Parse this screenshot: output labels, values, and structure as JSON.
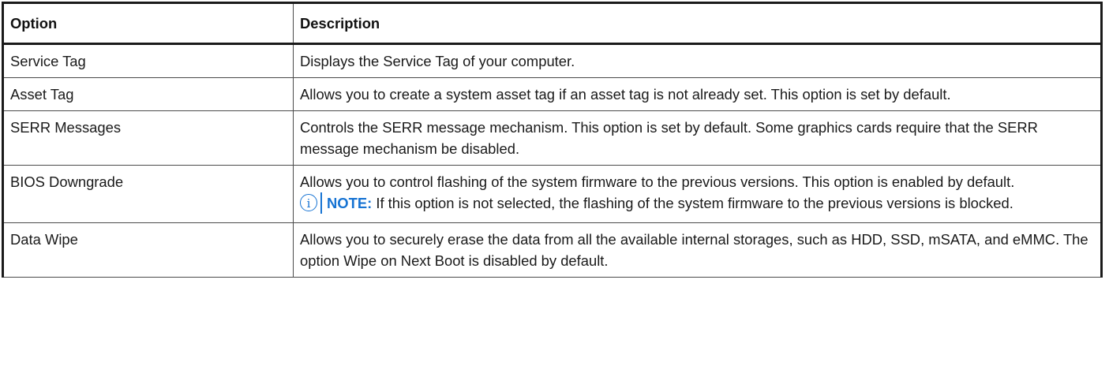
{
  "table": {
    "headers": {
      "option": "Option",
      "description": "Description"
    },
    "rows": [
      {
        "option": "Service Tag",
        "description": "Displays the Service Tag of your computer."
      },
      {
        "option": "Asset Tag",
        "description": "Allows you to create a system asset tag if an asset tag is not already set. This option is set by default."
      },
      {
        "option": "SERR Messages",
        "description": "Controls the SERR message mechanism. This option is set by default. Some graphics cards require that the SERR message mechanism be disabled."
      },
      {
        "option": "BIOS Downgrade",
        "description": "Allows you to control flashing of the system firmware to the previous versions. This option is enabled by default.",
        "note_label": "NOTE:",
        "note_text": " If this option is not selected, the flashing of the system firmware to the previous versions is blocked.",
        "note_icon": "info-icon"
      },
      {
        "option": "Data Wipe",
        "description": "Allows you to securely erase the data from all the available internal storages, such as HDD, SSD, mSATA, and eMMC. The option Wipe on Next Boot is disabled by default."
      }
    ]
  },
  "colors": {
    "note_accent": "#1673d3",
    "border": "#1a1a1a",
    "text": "#1a1a1a"
  }
}
